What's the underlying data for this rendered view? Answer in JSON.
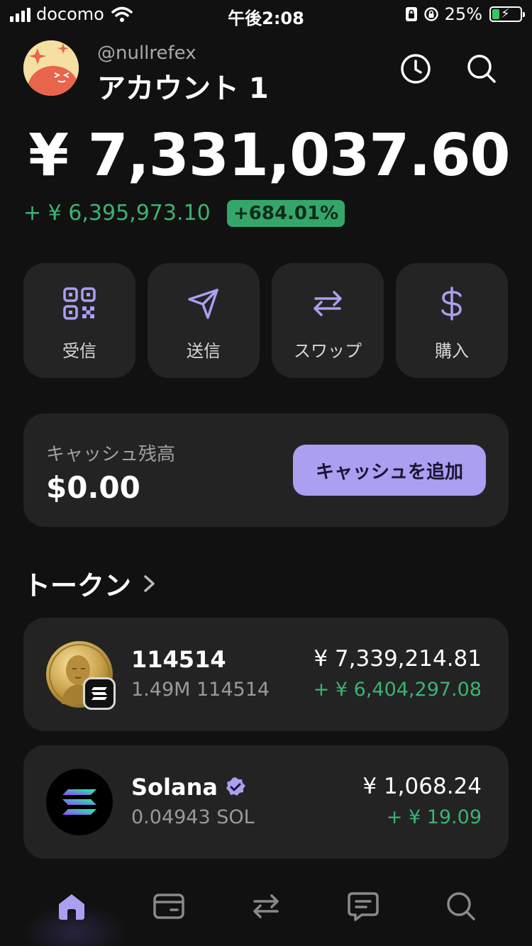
{
  "status_bar": {
    "carrier": "docomo",
    "time": "午後2:08",
    "battery": "25%"
  },
  "header": {
    "username": "@nullrefex",
    "account_name": "アカウント 1",
    "icons": [
      "history-icon",
      "search-icon"
    ]
  },
  "balance": {
    "total": "¥ 7,331,037.60",
    "change_amount": "+ ¥ 6,395,973.10",
    "change_percent": "+684.01%"
  },
  "actions": [
    {
      "label": "受信",
      "icon": "qr-code-icon"
    },
    {
      "label": "送信",
      "icon": "send-icon"
    },
    {
      "label": "スワップ",
      "icon": "swap-icon"
    },
    {
      "label": "購入",
      "icon": "dollar-icon"
    }
  ],
  "cash": {
    "label": "キャッシュ残高",
    "value": "$0.00",
    "button": "キャッシュを追加"
  },
  "tokens_heading": "トークン",
  "tokens": [
    {
      "name": "114514",
      "amount": "1.49M 114514",
      "value": "¥ 7,339,214.81",
      "change": "+ ¥ 6,404,297.08"
    },
    {
      "name": "Solana",
      "amount": "0.04943 SOL",
      "value": "¥ 1,068.24",
      "change": "+ ¥ 19.09"
    }
  ],
  "bottom_nav": [
    "home-icon",
    "wallet-icon",
    "swap-icon",
    "chat-icon",
    "search-icon"
  ],
  "colors": {
    "accent": "#ab9ff2",
    "positive": "#3cb371",
    "background": "#111111",
    "card": "#232323"
  }
}
